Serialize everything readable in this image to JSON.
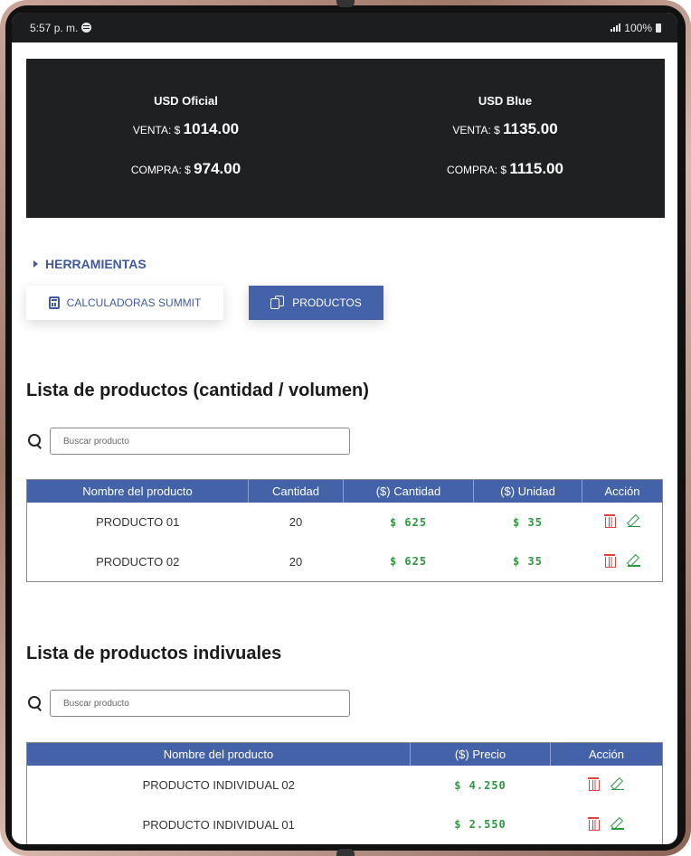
{
  "status_bar": {
    "time": "5:57 p. m.",
    "battery": "100%"
  },
  "rates": {
    "oficial": {
      "title": "USD Oficial",
      "venta_label": "VENTA: $",
      "venta_value": "1014.00",
      "compra_label": "COMPRA: $",
      "compra_value": "974.00"
    },
    "blue": {
      "title": "USD Blue",
      "venta_label": "VENTA: $",
      "venta_value": "1135.00",
      "compra_label": "COMPRA: $",
      "compra_value": "1115.00"
    }
  },
  "tools": {
    "toggle_label": "HERRAMIENTAS",
    "calc_button_label": "CALCULADORAS SUMMIT",
    "products_button_label": "PRODUCTOS"
  },
  "products_volume": {
    "title": "Lista de productos (cantidad / volumen)",
    "search_placeholder": "Buscar producto",
    "headers": [
      "Nombre del producto",
      "Cantidad",
      "($) Cantidad",
      "($) Unidad",
      "Acción"
    ],
    "rows": [
      {
        "name": "PRODUCTO 01",
        "quantity": "20",
        "total": "$ 625",
        "unit": "$ 35"
      },
      {
        "name": "PRODUCTO 02",
        "quantity": "20",
        "total": "$ 625",
        "unit": "$ 35"
      }
    ]
  },
  "products_individual": {
    "title": "Lista de productos indivuales",
    "search_placeholder": "Buscar producto",
    "headers": [
      "Nombre del producto",
      "($) Precio",
      "Acción"
    ],
    "rows": [
      {
        "name": "PRODUCTO INDIVIDUAL 02",
        "price": "$ 4.250"
      },
      {
        "name": "PRODUCTO INDIVIDUAL 01",
        "price": "$ 2.550"
      }
    ]
  },
  "colors": {
    "accent": "#4462a8",
    "money": "#2b9a3f",
    "danger": "#e0433f",
    "banner": "#1f2022"
  }
}
